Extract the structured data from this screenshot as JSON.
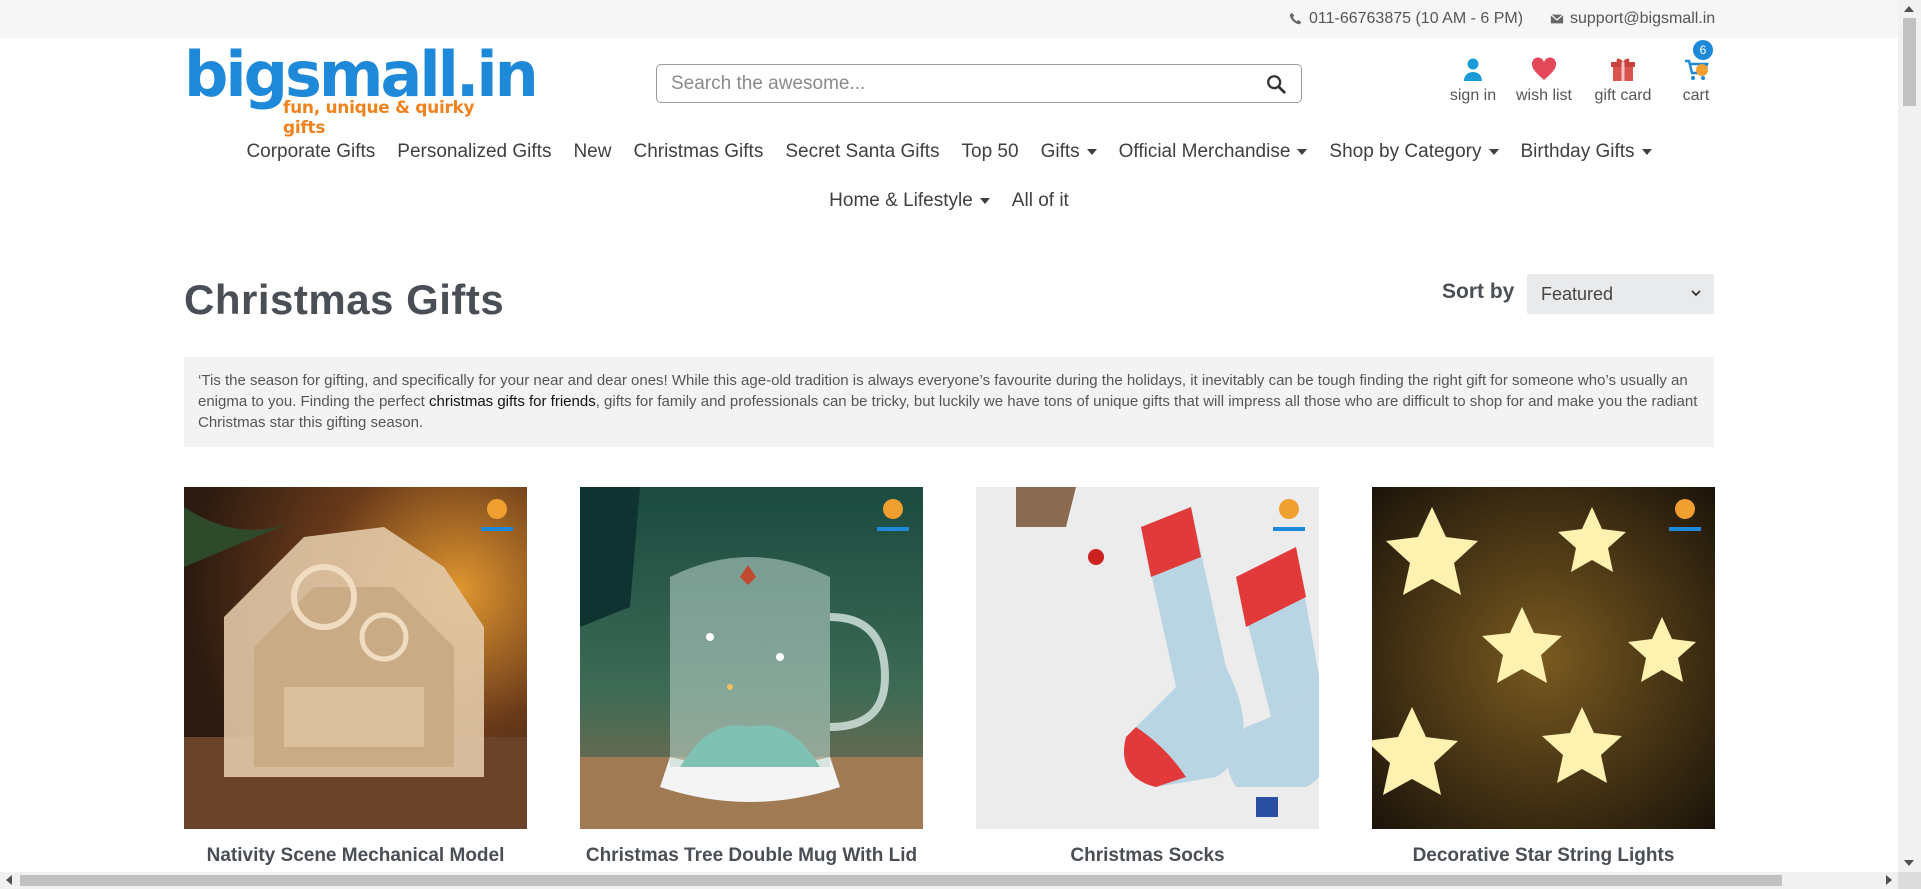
{
  "topbar": {
    "phone": "011-66763875 (10 AM - 6 PM)",
    "email": "support@bigsmall.in"
  },
  "logo": {
    "name": "bigsmall.in",
    "tagline": "fun, unique & quirky gifts"
  },
  "search": {
    "placeholder": "Search the awesome..."
  },
  "header_actions": {
    "signin": "sign in",
    "wishlist": "wish list",
    "giftcard": "gift card",
    "cart": "cart",
    "cart_count": "6"
  },
  "nav": {
    "row1": [
      {
        "label": "Corporate Gifts",
        "dropdown": false
      },
      {
        "label": "Personalized Gifts",
        "dropdown": false
      },
      {
        "label": "New",
        "dropdown": false
      },
      {
        "label": "Christmas Gifts",
        "dropdown": false
      },
      {
        "label": "Secret Santa Gifts",
        "dropdown": false
      },
      {
        "label": "Top 50",
        "dropdown": false
      },
      {
        "label": "Gifts",
        "dropdown": true
      },
      {
        "label": "Official Merchandise",
        "dropdown": true
      },
      {
        "label": "Shop by Category",
        "dropdown": true
      },
      {
        "label": "Birthday Gifts",
        "dropdown": true
      }
    ],
    "row2": [
      {
        "label": "Home & Lifestyle",
        "dropdown": true
      },
      {
        "label": "All of it",
        "dropdown": false
      }
    ]
  },
  "page": {
    "title": "Christmas Gifts",
    "sort_label": "Sort by",
    "sort_value": "Featured"
  },
  "description": {
    "part1": "‘Tis the season for gifting, and specifically for your near and dear ones! While this age-old tradition is always everyone’s favourite during the holidays, it inevitably can be tough finding the right gift for someone who’s usually an enigma to you. Finding the perfect ",
    "link": "christmas gifts for friends",
    "part2": ", gifts for family and professionals can be tricky, but luckily we have tons of unique gifts that will impress all those who are difficult to shop for and make you the radiant Christmas star this gifting season."
  },
  "products": [
    {
      "name": "Nativity Scene Mechanical Model"
    },
    {
      "name": "Christmas Tree Double Mug With Lid"
    },
    {
      "name": "Christmas Socks"
    },
    {
      "name": "Decorative Star String Lights"
    }
  ],
  "colors": {
    "brand_blue": "#1e88d9",
    "brand_orange": "#f0831e",
    "heart": "#e2475a",
    "gift": "#d9534f",
    "signin": "#1a9bd7"
  }
}
